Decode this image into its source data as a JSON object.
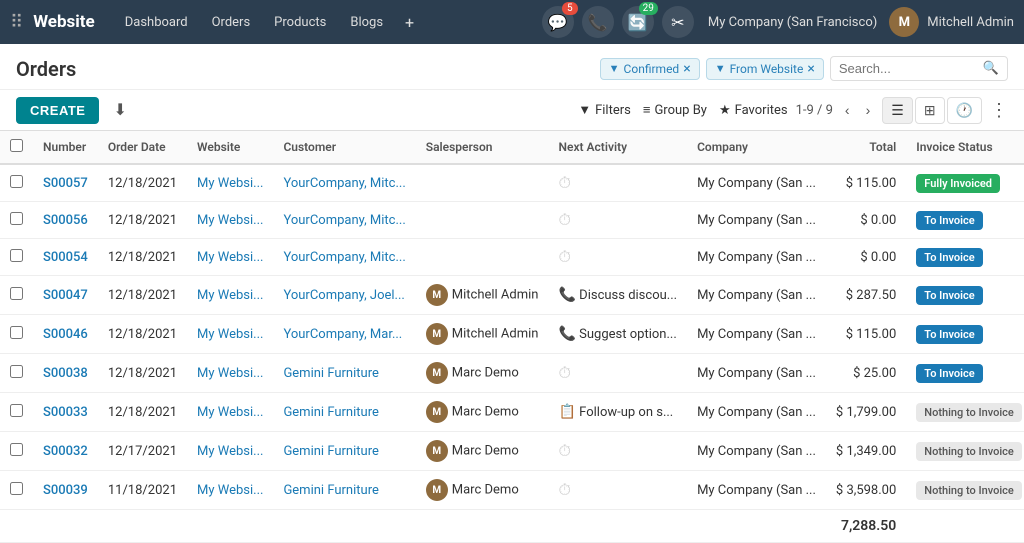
{
  "topnav": {
    "brand": "Website",
    "items": [
      "Dashboard",
      "Orders",
      "Products",
      "Blogs"
    ],
    "plus_label": "+",
    "chat_badge": "5",
    "phone_label": "📞",
    "refresh_badge": "29",
    "settings_label": "⚙",
    "company": "My Company (San Francisco)",
    "username": "Mitchell Admin"
  },
  "page": {
    "title": "Orders"
  },
  "filters": {
    "confirmed_label": "Confirmed",
    "from_website_label": "From Website",
    "search_placeholder": "Search..."
  },
  "toolbar": {
    "create_label": "CREATE",
    "filters_label": "Filters",
    "group_by_label": "Group By",
    "favorites_label": "Favorites",
    "pagination": "1-9 / 9"
  },
  "table": {
    "columns": [
      "Number",
      "Order Date",
      "Website",
      "Customer",
      "Salesperson",
      "Next Activity",
      "Company",
      "Total",
      "Invoice Status"
    ],
    "rows": [
      {
        "id": "S00057",
        "date": "12/18/2021",
        "website": "My Websi...",
        "customer": "YourCompany, Mitc...",
        "salesperson": "",
        "salesperson_avatar": false,
        "activity": "clock",
        "activity_text": "",
        "company": "My Company (San ...",
        "total": "$ 115.00",
        "status": "Fully Invoiced",
        "status_type": "fully"
      },
      {
        "id": "S00056",
        "date": "12/18/2021",
        "website": "My Websi...",
        "customer": "YourCompany, Mitc...",
        "salesperson": "",
        "salesperson_avatar": false,
        "activity": "clock",
        "activity_text": "",
        "company": "My Company (San ...",
        "total": "$ 0.00",
        "status": "To Invoice",
        "status_type": "to-invoice"
      },
      {
        "id": "S00054",
        "date": "12/18/2021",
        "website": "My Websi...",
        "customer": "YourCompany, Mitc...",
        "salesperson": "",
        "salesperson_avatar": false,
        "activity": "clock",
        "activity_text": "",
        "company": "My Company (San ...",
        "total": "$ 0.00",
        "status": "To Invoice",
        "status_type": "to-invoice"
      },
      {
        "id": "S00047",
        "date": "12/18/2021",
        "website": "My Websi...",
        "customer": "YourCompany, Joel...",
        "salesperson": "Mitchell Admin",
        "salesperson_avatar": true,
        "activity": "phone",
        "activity_text": "Discuss discou...",
        "company": "My Company (San ...",
        "total": "$ 287.50",
        "status": "To Invoice",
        "status_type": "to-invoice"
      },
      {
        "id": "S00046",
        "date": "12/18/2021",
        "website": "My Websi...",
        "customer": "YourCompany, Mar...",
        "salesperson": "Mitchell Admin",
        "salesperson_avatar": true,
        "activity": "phone",
        "activity_text": "Suggest option...",
        "company": "My Company (San ...",
        "total": "$ 115.00",
        "status": "To Invoice",
        "status_type": "to-invoice"
      },
      {
        "id": "S00038",
        "date": "12/18/2021",
        "website": "My Websi...",
        "customer": "Gemini Furniture",
        "salesperson": "Marc Demo",
        "salesperson_avatar": true,
        "activity": "clock",
        "activity_text": "",
        "company": "My Company (San ...",
        "total": "$ 25.00",
        "status": "To Invoice",
        "status_type": "to-invoice"
      },
      {
        "id": "S00033",
        "date": "12/18/2021",
        "website": "My Websi...",
        "customer": "Gemini Furniture",
        "salesperson": "Marc Demo",
        "salesperson_avatar": true,
        "activity": "task",
        "activity_text": "Follow-up on s...",
        "company": "My Company (San ...",
        "total": "$ 1,799.00",
        "status": "Nothing to Invoice",
        "status_type": "nothing"
      },
      {
        "id": "S00032",
        "date": "12/17/2021",
        "website": "My Websi...",
        "customer": "Gemini Furniture",
        "salesperson": "Marc Demo",
        "salesperson_avatar": true,
        "activity": "clock",
        "activity_text": "",
        "company": "My Company (San ...",
        "total": "$ 1,349.00",
        "status": "Nothing to Invoice",
        "status_type": "nothing"
      },
      {
        "id": "S00039",
        "date": "11/18/2021",
        "website": "My Websi...",
        "customer": "Gemini Furniture",
        "salesperson": "Marc Demo",
        "salesperson_avatar": true,
        "activity": "clock",
        "activity_text": "",
        "company": "My Company (San ...",
        "total": "$ 3,598.00",
        "status": "Nothing to Invoice",
        "status_type": "nothing"
      }
    ],
    "footer_total": "7,288.50"
  }
}
